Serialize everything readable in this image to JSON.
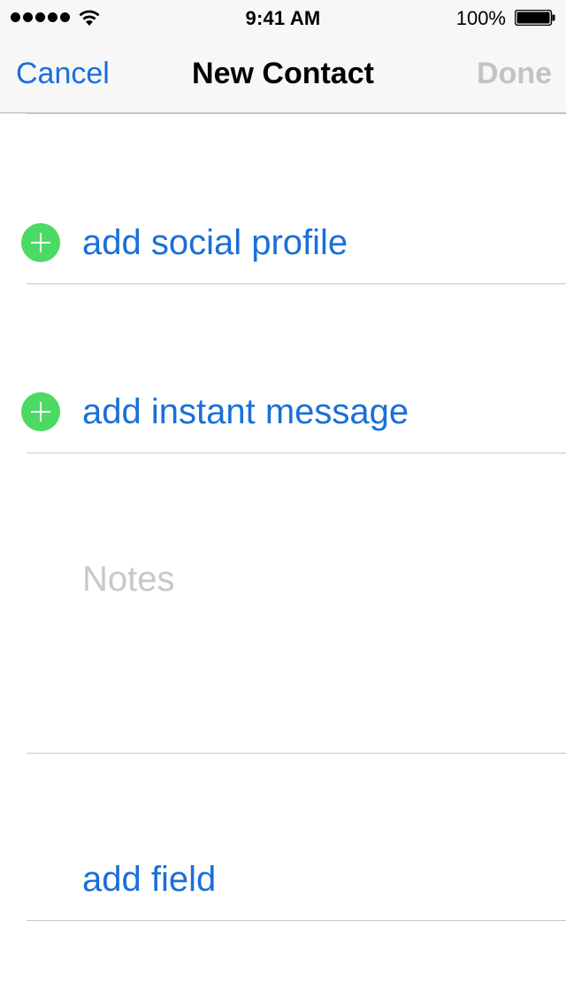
{
  "status_bar": {
    "time": "9:41 AM",
    "battery_percent": "100%",
    "signal_icon": "signal-dots-icon",
    "wifi_icon": "wifi-icon",
    "battery_icon": "battery-full-icon"
  },
  "nav": {
    "cancel_label": "Cancel",
    "title": "New Contact",
    "done_label": "Done"
  },
  "form": {
    "social_profile_label": "add social profile",
    "instant_message_label": "add instant message",
    "notes_placeholder": "Notes",
    "add_field_label": "add field"
  },
  "colors": {
    "accent": "#1a6fd9",
    "add_green": "#4cd964",
    "disabled": "#c3c3c6",
    "placeholder": "#c7c7cd"
  }
}
